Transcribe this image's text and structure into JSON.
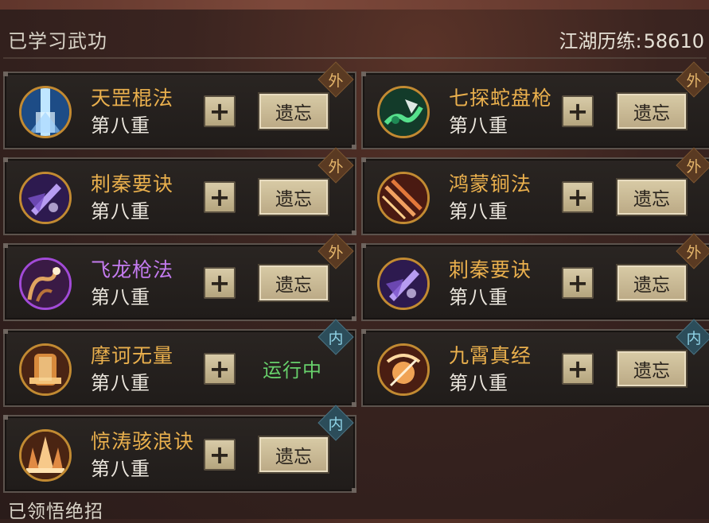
{
  "header": {
    "learned_title": "已学习武功",
    "exp_label": "江湖历练:",
    "exp_value": "58610"
  },
  "skills": [
    {
      "name": "天罡棍法",
      "level": "第八重",
      "type": "外",
      "action": "遗忘",
      "icon": "light-beam-icon"
    },
    {
      "name": "七探蛇盘枪",
      "level": "第八重",
      "type": "外",
      "action": "遗忘",
      "icon": "serpent-spear-icon"
    },
    {
      "name": "刺秦要诀",
      "level": "第八重",
      "type": "外",
      "action": "遗忘",
      "icon": "purple-blade-icon"
    },
    {
      "name": "鸿蒙锏法",
      "level": "第八重",
      "type": "外",
      "action": "遗忘",
      "icon": "crossed-maces-icon"
    },
    {
      "name": "飞龙枪法",
      "level": "第八重",
      "type": "外",
      "action": "遗忘",
      "icon": "flying-dragon-icon"
    },
    {
      "name": "刺秦要诀",
      "level": "第八重",
      "type": "外",
      "action": "遗忘",
      "icon": "purple-blade-icon"
    },
    {
      "name": "摩诃无量",
      "level": "第八重",
      "type": "内",
      "status": "运行中",
      "icon": "golden-bell-icon"
    },
    {
      "name": "九霄真经",
      "level": "第八重",
      "type": "内",
      "action": "遗忘",
      "icon": "radiant-palm-icon"
    },
    {
      "name": "惊涛骇浪诀",
      "level": "第八重",
      "type": "内",
      "action": "遗忘",
      "icon": "wave-burst-icon"
    }
  ],
  "plus_label": "+",
  "footer": {
    "comprehended_title": "已领悟绝招"
  },
  "colors": {
    "name_gold": "#eab04d",
    "name_purple": "#c47bf0",
    "running_green": "#67d06b"
  }
}
